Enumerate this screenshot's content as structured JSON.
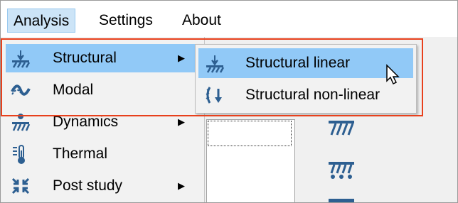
{
  "menubar": {
    "items": [
      {
        "label": "Analysis",
        "active": true
      },
      {
        "label": "Settings",
        "active": false
      },
      {
        "label": "About",
        "active": false
      }
    ]
  },
  "analysis_menu": {
    "items": [
      {
        "label": "Structural",
        "icon": "structural-icon",
        "has_submenu": true,
        "highlighted": true
      },
      {
        "label": "Modal",
        "icon": "modal-icon",
        "has_submenu": false,
        "highlighted": false
      },
      {
        "label": "Dynamics",
        "icon": "dynamics-icon",
        "has_submenu": true,
        "highlighted": false
      },
      {
        "label": "Thermal",
        "icon": "thermal-icon",
        "has_submenu": false,
        "highlighted": false
      },
      {
        "label": "Post study",
        "icon": "post-study-icon",
        "has_submenu": true,
        "highlighted": false
      }
    ],
    "submenu_arrow": "▶"
  },
  "structural_submenu": {
    "items": [
      {
        "label": "Structural linear",
        "icon": "structural-linear-icon",
        "highlighted": true
      },
      {
        "label": "Structural non-linear",
        "icon": "structural-nonlinear-icon",
        "highlighted": false
      }
    ]
  },
  "colors": {
    "highlight": "#91c9f7",
    "menu_bg": "#f2f2f2",
    "annotation": "#e8401c",
    "icon_blue": "#2d5f91"
  }
}
